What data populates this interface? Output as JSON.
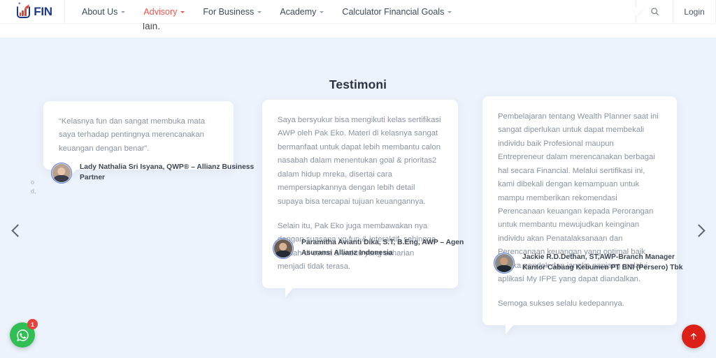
{
  "header": {
    "logo_text": "FIN",
    "logo_icon": "bar-chart-logo-icon",
    "nav": [
      {
        "label": "About Us",
        "active": false,
        "has_caret": true
      },
      {
        "label": "Advisory",
        "active": true,
        "has_caret": true
      },
      {
        "label": "For Business",
        "active": false,
        "has_caret": true
      },
      {
        "label": "Academy",
        "active": false,
        "has_caret": true
      },
      {
        "label": "Calculator Financial Goals",
        "active": false,
        "has_caret": true
      }
    ],
    "search_icon": "search-icon",
    "login_label": "Login",
    "active_color": "#f0544a"
  },
  "previous_section": {
    "trailing_text": "lain."
  },
  "section": {
    "title": "Testimoni",
    "background_color": "#edf3fc",
    "stray_glyphs": "o\nd,"
  },
  "carousel": {
    "prev_label": "‹",
    "next_label": "›",
    "prev_icon": "chevron-left-icon",
    "next_icon": "chevron-right-icon"
  },
  "testimonials": [
    {
      "paragraphs": [
        "“Kelasnya fun dan sangat membuka mata saya terhadap pentingnya merencanakan keuangan dengan benar”."
      ],
      "author": "Lady Nathalia Sri Isyana, QWP® – Allianz Business Partner",
      "avatar_name": "avatar-lady-nathalia"
    },
    {
      "paragraphs": [
        "Saya bersyukur bisa mengikuti kelas sertifikasi AWP oleh Pak Eko. Materi di kelasnya sangat bermanfaat untuk dapat lebih membantu calon nasabah dalam menentukan goal & prioritas2 dalam hidup mreka, disertai cara mempersiapkannya dengan lebih detail supaya bisa tercapai tujuan keuangannya.",
        "Selain itu, Pak Eko juga membawakan nya dengan suasana yg fun & interaktif, sehingga mudah di cerna & waktu yang seharian menjadi tidak terasa."
      ],
      "author": "Paramitha Avianti Dika, S.T, B.Eng, AWP – Agen Asuransi Allianz Indonesia",
      "avatar_name": "avatar-paramitha-avianti"
    },
    {
      "paragraphs": [
        "Pembelajaran tentang Wealth Planner saat ini sangat diperlukan untuk dapat membekali individu baik Profesional maupun Entrepreneur dalam merencanakan berbagai hal secara Financial. Melalui sertifikasi ini, kami dibekali dengan kemampuan untuk mampu memberikan rekomendasi Perencanaan keuangan kepada Perorangan untuk membantu mewujudkan keinginan individu akan Penatalaksanaan dan Perencanaan keuangan yang optimal baik jangka pendek dan jangka panjang melalui aplikasi My IFPE yang dapat diandalkan.",
        "Semoga sukses selalu kedepannya."
      ],
      "author": "Jackie R.D.Dethan, ST,AWP-Branch Manager Kantor Cabang Kebumen PT BNI (Persero) Tbk",
      "avatar_name": "avatar-jackie-dethan"
    }
  ],
  "floating": {
    "whatsapp_icon": "whatsapp-icon",
    "whatsapp_badge": "1",
    "whatsapp_color": "#2fbf52",
    "scroll_top_icon": "arrow-up-icon",
    "scroll_top_color": "#dc2018"
  }
}
